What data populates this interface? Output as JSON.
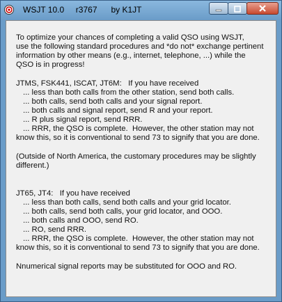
{
  "window": {
    "title": "WSJT 10.0     r3767      by K1JT",
    "icons": {
      "app": "radio-app-icon",
      "minimize": "minimize-icon",
      "maximize": "maximize-icon",
      "close": "close-icon"
    },
    "colors": {
      "titlebar": "#6a9cc8",
      "close": "#c84a30",
      "client": "#f0f0f0"
    }
  },
  "content": {
    "intro": [
      "To optimize your chances of completing a valid QSO using WSJT,",
      "use the following standard procedures and *do not* exchange pertinent",
      "information by other means (e.g., internet, telephone, ...) while the",
      "QSO is in progress!"
    ],
    "section1_header": "JTMS, FSK441, ISCAT, JT6M:   If you have received",
    "section1_items": [
      "... less than both calls from the other station, send both calls.",
      "... both calls, send both calls and your signal report.",
      "... both calls and signal report, send R and your report.",
      "... R plus signal report, send RRR.",
      "... RRR, the QSO is complete.  However, the other station may not"
    ],
    "section1_tail": "know this, so it is conventional to send 73 to signify that you are done.",
    "note": [
      "(Outside of North America, the customary procedures may be slightly",
      "different.)"
    ],
    "section2_header": "JT65, JT4:   If you have received",
    "section2_items": [
      "... less than both calls, send both calls and your grid locator.",
      "... both calls, send both calls, your grid locator, and OOO.",
      "... both calls and OOO, send RO.",
      "... RO, send RRR.",
      "... RRR, the QSO is complete.  However, the other station may not"
    ],
    "section2_tail": "know this, so it is conventional to send 73 to signify that you are done.",
    "footer": "Nnumerical signal reports may be substituted for OOO and RO."
  }
}
